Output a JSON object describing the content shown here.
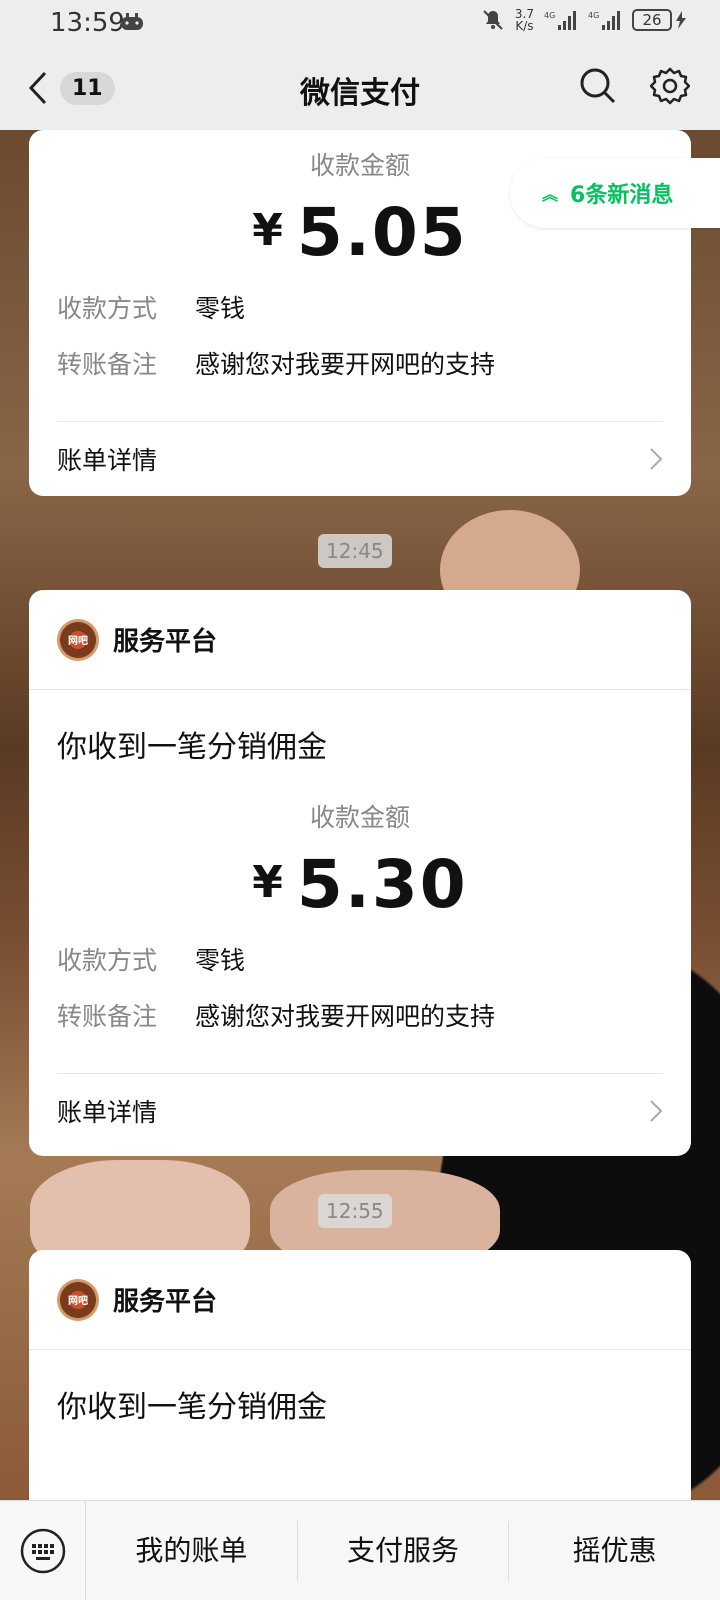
{
  "status": {
    "time": "13:59",
    "speed_value": "3.7",
    "speed_unit": "K/s",
    "net1": "4G",
    "net2": "4G",
    "battery": "26"
  },
  "nav": {
    "unread_count": "11",
    "title": "微信支付"
  },
  "new_messages": "6条新消息",
  "cards": [
    {
      "amount_label": "收款金额",
      "currency": "¥",
      "amount": "5.05",
      "method_label": "收款方式",
      "method_value": "零钱",
      "note_label": "转账备注",
      "note_value": "感谢您对我要开网吧的支持",
      "bill_label": "账单详情"
    },
    {
      "source": "服务平台",
      "subject": "你收到一笔分销佣金",
      "amount_label": "收款金额",
      "currency": "¥",
      "amount": "5.30",
      "method_label": "收款方式",
      "method_value": "零钱",
      "note_label": "转账备注",
      "note_value": "感谢您对我要开网吧的支持",
      "bill_label": "账单详情"
    },
    {
      "source": "服务平台",
      "subject": "你收到一笔分销佣金"
    }
  ],
  "timestamps": [
    "12:45",
    "12:55"
  ],
  "avatar_text": "网吧",
  "bottom_menu": [
    "我的账单",
    "支付服务",
    "摇优惠"
  ],
  "colors": {
    "accent_green": "#07c160",
    "background": "#ededed"
  }
}
